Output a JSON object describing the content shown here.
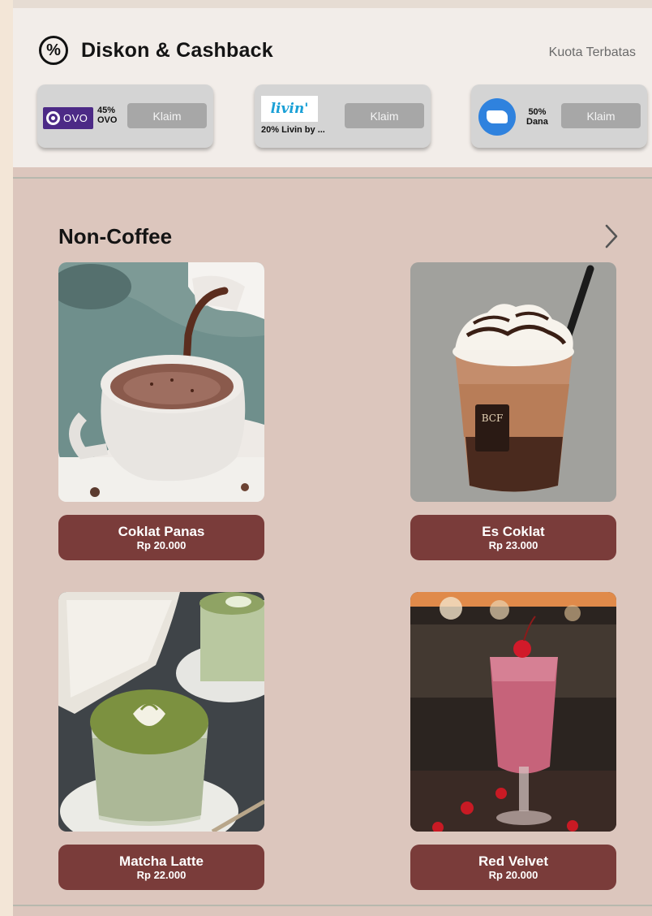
{
  "discount": {
    "title": "Diskon & Cashback",
    "quota_label": "Kuota Terbatas",
    "promos": [
      {
        "brand": "ovo",
        "logo_text": "OVO",
        "percent": "45%",
        "name": "OVO",
        "claim_label": "Klaim"
      },
      {
        "brand": "livin",
        "logo_text": "livin'",
        "percent": "20%",
        "name": "20% Livin by ...",
        "claim_label": "Klaim"
      },
      {
        "brand": "dana",
        "percent": "50%",
        "name": "Dana",
        "claim_label": "Klaim"
      }
    ]
  },
  "section": {
    "title": "Non-Coffee",
    "icons": {
      "header": "percent-circle-icon",
      "more": "chevron-right-icon"
    }
  },
  "products": [
    {
      "name": "Coklat Panas",
      "price": "Rp 20.000"
    },
    {
      "name": "Es Coklat",
      "price": "Rp 23.000"
    },
    {
      "name": "Matcha Latte",
      "price": "Rp 22.000"
    },
    {
      "name": "Red Velvet",
      "price": "Rp 20.000"
    }
  ],
  "colors": {
    "page_bg": "#f3e6d7",
    "content_bg": "#dcc6bd",
    "discount_bg": "#f2ede9",
    "card_bg": "#d4d4d4",
    "claim_button": "#a7a7a7",
    "product_label_bg": "#7a3c3a",
    "ovo_purple": "#4c2a86",
    "livin_blue": "#1aa0d6",
    "dana_blue": "#2f82de"
  }
}
